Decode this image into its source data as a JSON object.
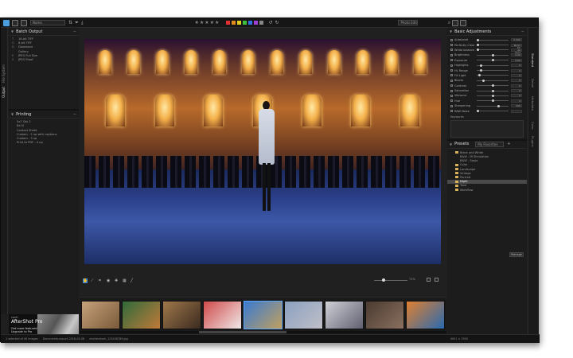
{
  "topbar": {
    "search_placeholder": "Name",
    "stars": "★★★★★",
    "swatch_colors": [
      "#e03030",
      "#e08a20",
      "#e0d020",
      "#40c040",
      "#3070e0",
      "#a040d0",
      "#888888"
    ],
    "preset_select": "Photo Edit"
  },
  "left_tabs": [
    "File System",
    "Output"
  ],
  "batch_output": {
    "title": "Batch Output",
    "items": [
      {
        "key": "T",
        "label": "16-bit TIFF"
      },
      {
        "key": "O",
        "label": "8-bit TIFF"
      },
      {
        "key": "D",
        "label": "Download"
      },
      {
        "key": "",
        "label": "Gallery"
      },
      {
        "key": "E",
        "label": "JPEG Full Size"
      },
      {
        "key": "S",
        "label": "JPEG Proof"
      }
    ]
  },
  "printing": {
    "title": "Printing",
    "items": [
      "5x7 Qty 2",
      "8x10",
      "Contact Sheet",
      "Custom - 2 up with captions",
      "Custom - 3 up",
      "Print to PDF - 4 up"
    ]
  },
  "ad": {
    "brand": "corel",
    "title": "AfterShot Pro",
    "sub": "Get more features! Upgrade to Pro",
    "button": "Learn more"
  },
  "viewer": {
    "zoom": "71%"
  },
  "basic_adjustments": {
    "title": "Basic Adjustments",
    "rows": [
      {
        "label": "AutoLevel",
        "value": "0.200",
        "pos": 0
      },
      {
        "label": "Perfectly Clear",
        "value": "Norm PC",
        "pos": 0
      },
      {
        "label": "White balance",
        "value": "As Shot",
        "pos": 0
      },
      {
        "label": "Brightness",
        "value": "0.00",
        "pos": 0.5
      },
      {
        "label": "Exposure",
        "value": "0.00",
        "pos": 0.5
      },
      {
        "label": "Highlights",
        "value": "0",
        "pos": 0.1
      },
      {
        "label": "HL Range",
        "value": "0",
        "pos": 0.1
      },
      {
        "label": "Fill Light",
        "value": "0",
        "pos": 0.05
      },
      {
        "label": "Blacks",
        "value": "0",
        "pos": 0.2
      },
      {
        "label": "Contrast",
        "value": "0",
        "pos": 0.5
      },
      {
        "label": "Saturation",
        "value": "0",
        "pos": 0.5
      },
      {
        "label": "Vibrance",
        "value": "0",
        "pos": 0.5
      },
      {
        "label": "Hue",
        "value": "0",
        "pos": 0.5
      },
      {
        "label": "Sharpening",
        "value": "100",
        "pos": 0.7
      },
      {
        "label": "RAW Noise",
        "value": "",
        "pos": 0
      }
    ],
    "keywords_label": "Keywords"
  },
  "presets": {
    "title": "Presets",
    "filter": "My Favorites",
    "items": [
      {
        "label": "Black and White",
        "indent": 0,
        "folder": true
      },
      {
        "label": "B&W - IR Simulation",
        "indent": 1,
        "folder": false
      },
      {
        "label": "B&W - Sepia",
        "indent": 1,
        "folder": false
      },
      {
        "label": "Color",
        "indent": 0,
        "folder": true
      },
      {
        "label": "Landscape",
        "indent": 0,
        "folder": true
      },
      {
        "label": "Vintage",
        "indent": 0,
        "folder": true
      },
      {
        "label": "Portrait",
        "indent": 0,
        "folder": true
      },
      {
        "label": "Night",
        "indent": 0,
        "folder": true,
        "highlight": true
      },
      {
        "label": "Tone",
        "indent": 0,
        "folder": true
      },
      {
        "label": "Workflow",
        "indent": 0,
        "folder": true
      }
    ],
    "manage_label": "Manage",
    "reset_label": "Reset All"
  },
  "right_tabs": [
    "Standard",
    "Detail",
    "Metadata",
    "Color",
    "Plugins"
  ],
  "thumbs": [
    {
      "colors": [
        "#c6a27a",
        "#7a5a3a"
      ]
    },
    {
      "colors": [
        "#2f6b3a",
        "#c07a3a"
      ]
    },
    {
      "colors": [
        "#a0784a",
        "#3a2a20"
      ]
    },
    {
      "colors": [
        "#d04a4a",
        "#f0e8e8"
      ]
    },
    {
      "colors": [
        "#3a7ad0",
        "#c0a060"
      ],
      "selected": true
    },
    {
      "colors": [
        "#8aa0c0",
        "#c0c0c8"
      ]
    },
    {
      "colors": [
        "#d0d0d8",
        "#606070"
      ]
    },
    {
      "colors": [
        "#4a3a30",
        "#8a7060"
      ]
    },
    {
      "colors": [
        "#e08030",
        "#2a6ab0"
      ]
    }
  ],
  "status": {
    "selection": "1 selected of 40 images",
    "file": "Documents-export-2016-05-08",
    "name": "shutterstock_123456789.jpg",
    "dims": "4001 × 3300"
  }
}
